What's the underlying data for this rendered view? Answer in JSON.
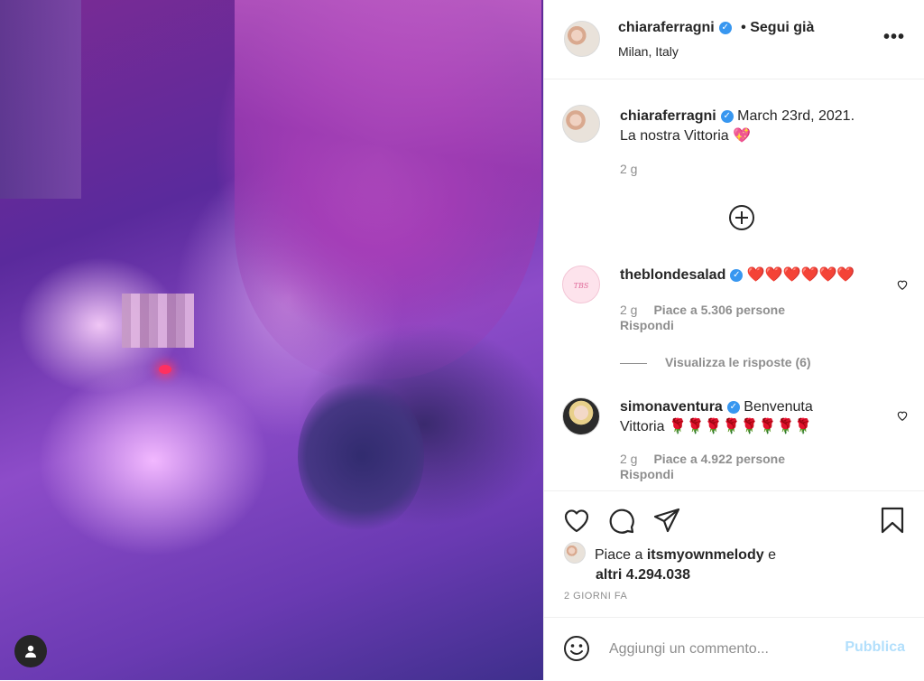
{
  "post": {
    "author": "chiaraferragni",
    "follow_status": "• Segui già",
    "location": "Milan, Italy",
    "more_label": "•••"
  },
  "caption": {
    "author": "chiaraferragni",
    "text_line1": "March 23rd, 2021.",
    "text_line2": "La nostra Vittoria 💖",
    "age": "2 g"
  },
  "comments": [
    {
      "author": "theblondesalad",
      "text": "❤️❤️❤️❤️❤️❤️",
      "age": "2 g",
      "likes": "Piace a 5.306 persone",
      "reply_label": "Rispondi",
      "view_replies": "Visualizza le risposte (6)"
    },
    {
      "author": "simonaventura",
      "text_line1": "Benvenuta",
      "text_line2": "Vittoria 🌹🌹🌹🌹🌹🌹🌹🌹",
      "age": "2 g",
      "likes": "Piace a 4.922 persone",
      "reply_label": "Rispondi"
    }
  ],
  "likes": {
    "prefix": "Piace a ",
    "user": "itsmyownmelody",
    "suffix": " e",
    "others": "altri 4.294.038"
  },
  "posted_time": "2 GIORNI FA",
  "add_comment": {
    "placeholder": "Aggiungi un commento...",
    "publish_label": "Pubblica"
  },
  "colors": {
    "verified": "#3897f0",
    "publish_disabled": "#b2dffc",
    "secondary_text": "#8e8e8e"
  }
}
